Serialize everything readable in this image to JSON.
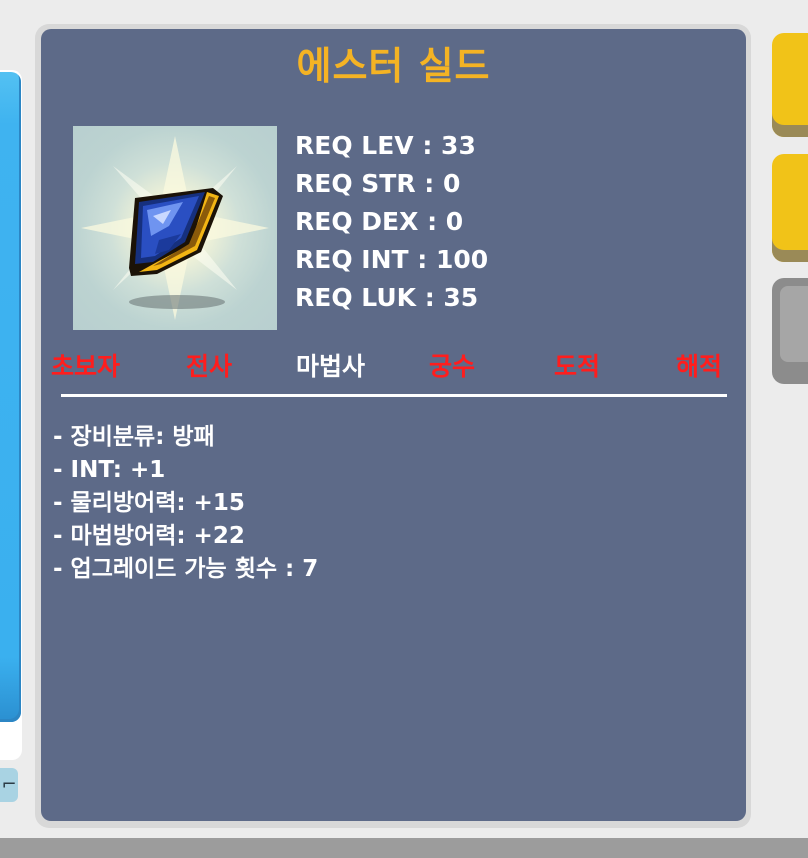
{
  "item": {
    "name": "에스터 실드",
    "requirements": [
      "REQ LEV : 33",
      "REQ STR : 0",
      "REQ DEX : 0",
      "REQ INT : 100",
      "REQ LUK : 35"
    ]
  },
  "classes": [
    {
      "label": "초보자",
      "state": "red"
    },
    {
      "label": "전사",
      "state": "red"
    },
    {
      "label": "마법사",
      "state": "white"
    },
    {
      "label": "궁수",
      "state": "red"
    },
    {
      "label": "도적",
      "state": "red"
    },
    {
      "label": "해적",
      "state": "red"
    }
  ],
  "stats": [
    "- 장비분류: 방패",
    "- INT: +1",
    "- 물리방어력: +15",
    "- 마법방어력: +22",
    "- 업그레이드 가능 횟수 : 7"
  ],
  "colors": {
    "panel": "#5d6a88",
    "title": "#f4b324",
    "restricted_class": "#ff1d1d",
    "allowed_class": "#ffffff",
    "button_yellow": "#f1c318",
    "sidebar_blue": "#3ab0ef"
  },
  "icons": {
    "item": "blue-shield-icon",
    "left_button": "stairs-icon"
  }
}
